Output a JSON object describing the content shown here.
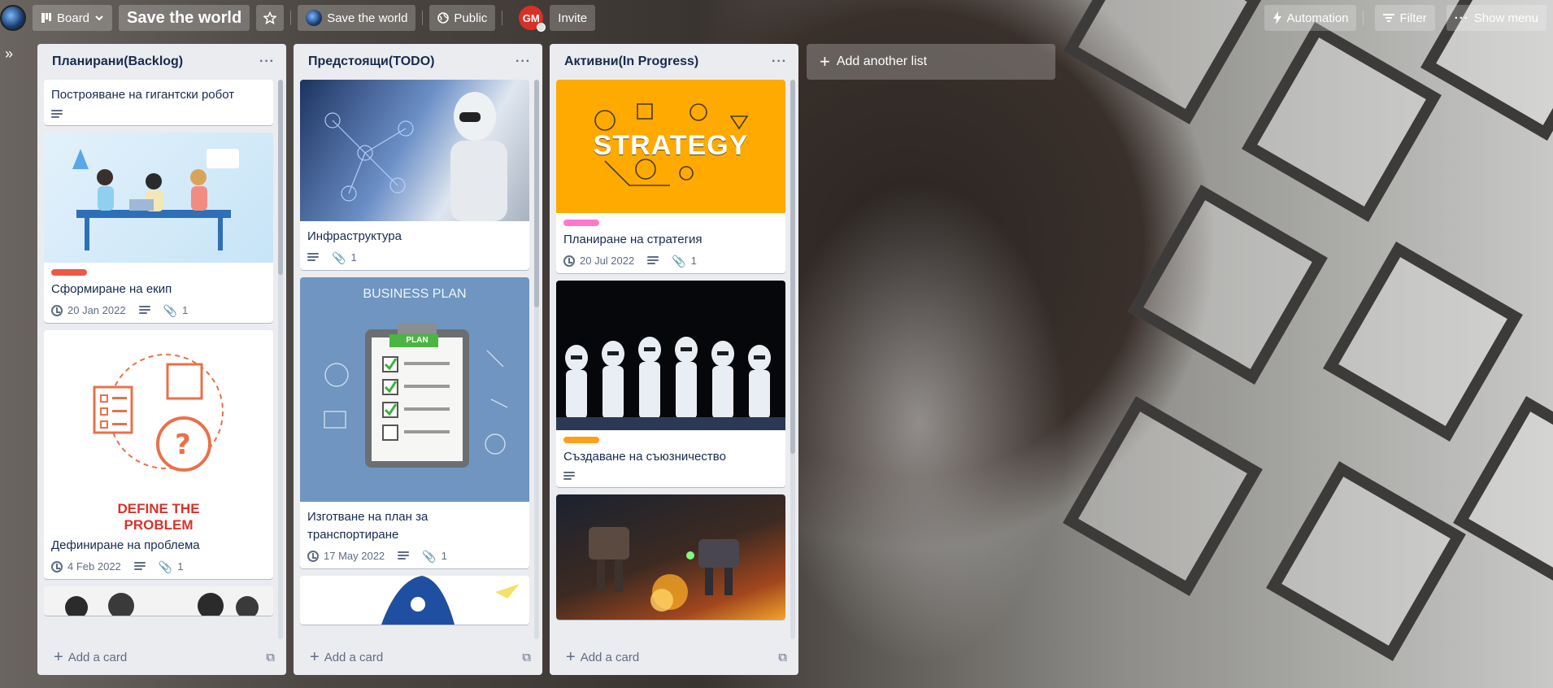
{
  "topbar": {
    "board_label": "Board",
    "board_title": "Save the world",
    "workspace_label": "Save the world",
    "visibility_label": "Public",
    "avatar_initials": "GM",
    "invite_label": "Invite",
    "automation_label": "Automation",
    "filter_label": "Filter",
    "show_menu_label": "Show menu"
  },
  "lists": [
    {
      "title": "Планирани(Backlog)",
      "add_card_label": "Add a card",
      "cards": [
        {
          "title": "Построяване на гигантски робот"
        },
        {
          "title": "Сформиране на екип",
          "label_color": "#eb5a46",
          "date": "20 Jan 2022",
          "attachments": "1"
        },
        {
          "title": "Дефиниране на проблема",
          "date": "4 Feb 2022",
          "attachments": "1",
          "cover_caption": "DEFINE THE PROBLEM"
        }
      ]
    },
    {
      "title": "Предстоящи(TODO)",
      "add_card_label": "Add a card",
      "cards": [
        {
          "title": "Инфраструктура",
          "attachments": "1"
        },
        {
          "title": "Изготване на план за транспортиране",
          "date": "17 May 2022",
          "attachments": "1",
          "cover_heading": "BUSINESS PLAN",
          "cover_badge": "PLAN"
        }
      ]
    },
    {
      "title": "Активни(In Progress)",
      "add_card_label": "Add a card",
      "cards": [
        {
          "title": "Планиране на стратегия",
          "label_color": "#ff78cb",
          "date": "20 Jul 2022",
          "attachments": "1",
          "cover_word": "STRATEGY"
        },
        {
          "title": "Създаване на съюзничество",
          "label_color": "#ff9f1a"
        }
      ]
    }
  ],
  "add_list_label": "Add another list",
  "colors": {
    "list_bg": "#ebecf0",
    "text": "#172b4d",
    "muted": "#5e6c84",
    "strategy_orange": "#ffaa00",
    "avatar_red": "#d93025"
  }
}
